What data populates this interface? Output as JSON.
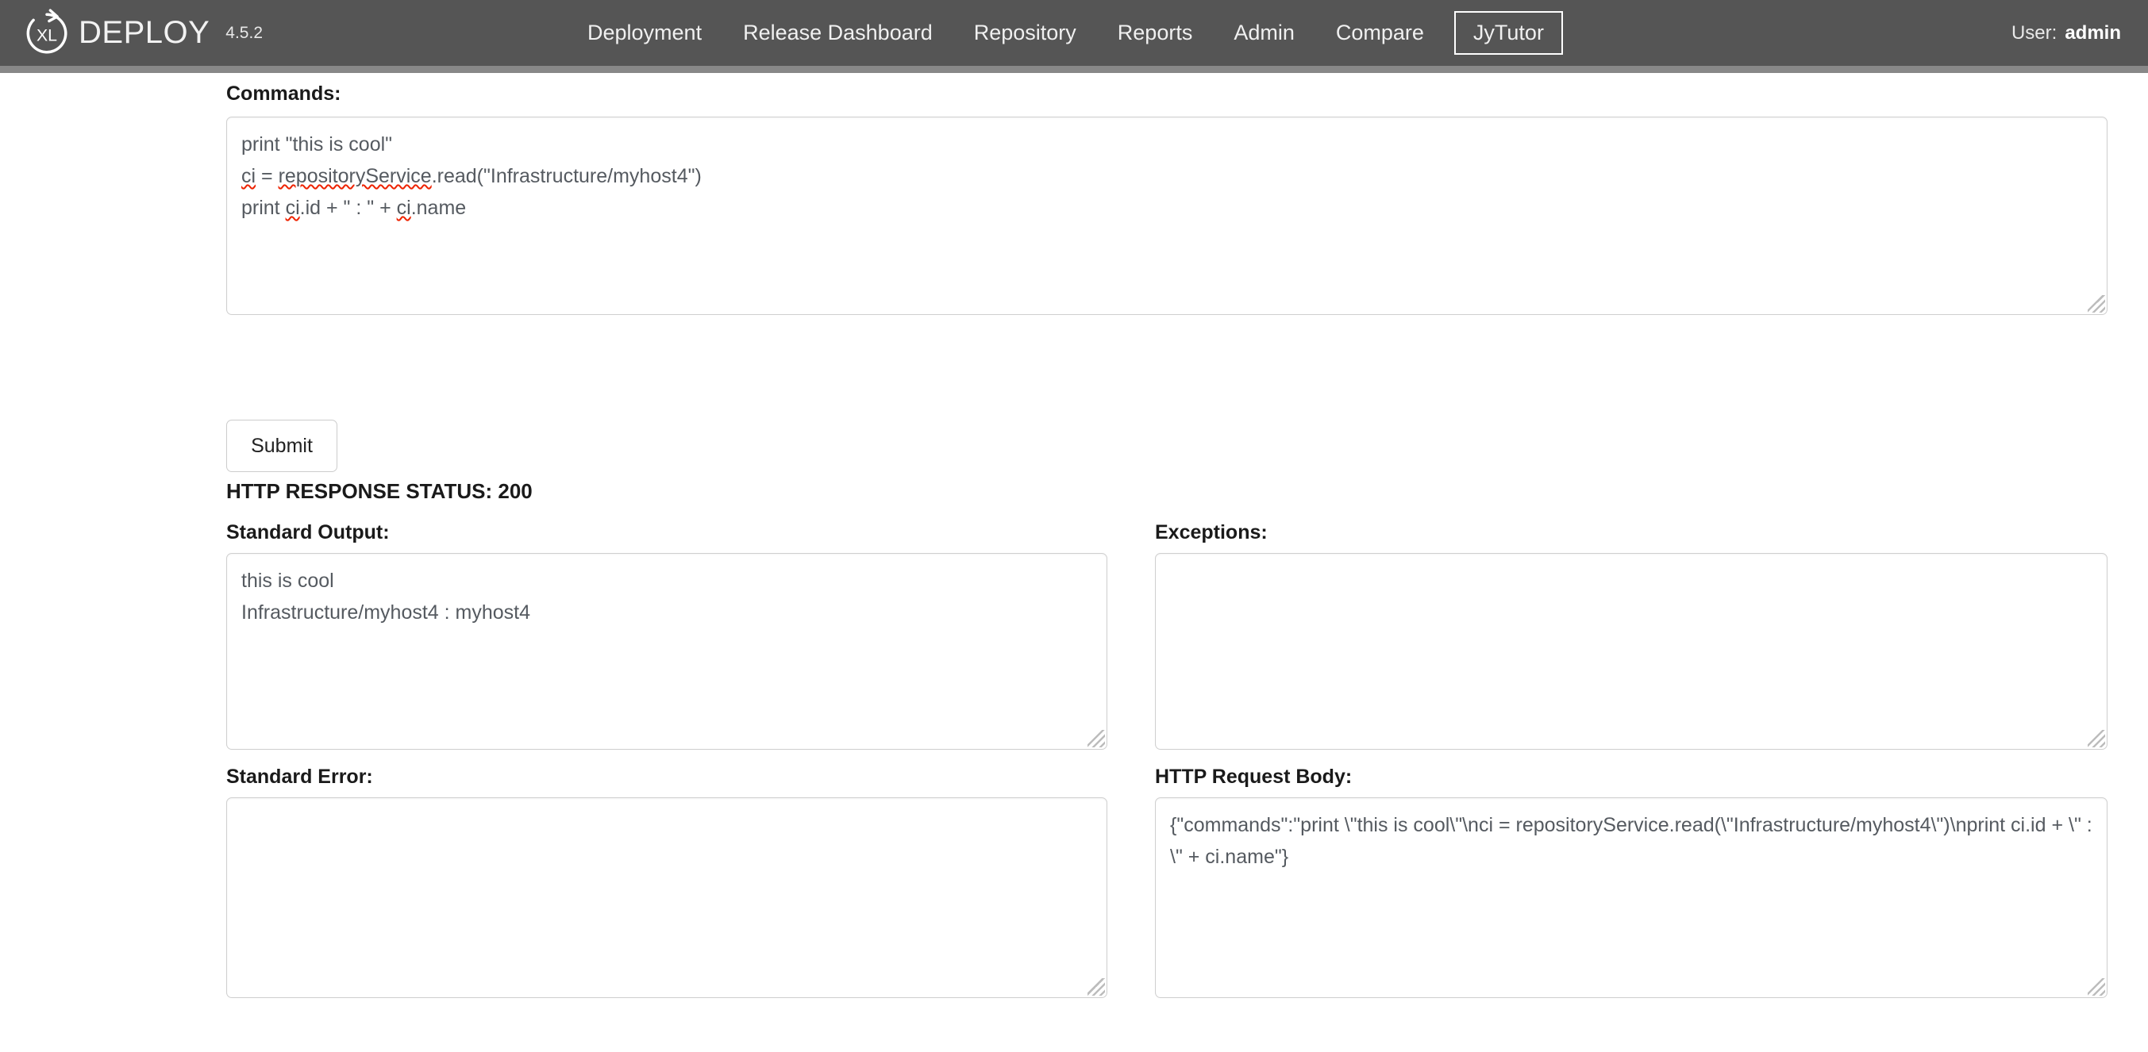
{
  "header": {
    "brand_name": "DEPLOY",
    "brand_logo_icon": "xl-circular-arrow-logo",
    "version": "4.5.2",
    "nav_items": [
      {
        "label": "Deployment",
        "name": "deployment",
        "active": false
      },
      {
        "label": "Release Dashboard",
        "name": "release-dashboard",
        "active": false
      },
      {
        "label": "Repository",
        "name": "repository",
        "active": false
      },
      {
        "label": "Reports",
        "name": "reports",
        "active": false
      },
      {
        "label": "Admin",
        "name": "admin",
        "active": false
      },
      {
        "label": "Compare",
        "name": "compare",
        "active": false
      },
      {
        "label": "JyTutor",
        "name": "jytutor",
        "active": true
      }
    ],
    "user_label": "User:",
    "user_name": "admin",
    "bar_color": "#555555",
    "underline_color": "#888888",
    "text_color": "#f0f0f0"
  },
  "main": {
    "commands": {
      "label": "Commands:",
      "value": "print \"this is cool\"\nci = repositoryService.read(\"Infrastructure/myhost4\")\nprint ci.id + \" : \" + ci.name",
      "line1": "print \"this is cool\"",
      "line2_a": "ci",
      "line2_b": " = ",
      "line2_c": "repositoryService",
      "line2_d": ".read(\"Infrastructure/myhost4\")",
      "line3_a": "print ",
      "line3_b": "ci",
      "line3_c": ".id + \" : \" + ",
      "line3_d": "ci",
      "line3_e": ".name"
    },
    "submit_label": "Submit",
    "http_status": "HTTP RESPONSE STATUS: 200",
    "http_status_code": "200",
    "standard_output": {
      "label": "Standard Output:",
      "value": "this is cool\nInfrastructure/myhost4 : myhost4"
    },
    "exceptions": {
      "label": "Exceptions:",
      "value": ""
    },
    "standard_error": {
      "label": "Standard Error:",
      "value": ""
    },
    "http_request_body": {
      "label": "HTTP Request Body:",
      "value": "{\"commands\":\"print \\\"this is cool\\\"\\nci = repositoryService.read(\\\"Infrastructure/myhost4\\\")\\nprint ci.id + \\\" : \\\" + ci.name\"}"
    }
  },
  "theme": {
    "page_background": "#ffffff",
    "field_border": "#cfcfcf",
    "field_text": "#555a60",
    "label_text": "#1a1a1a",
    "spellcheck_underline": "#ee2200"
  }
}
